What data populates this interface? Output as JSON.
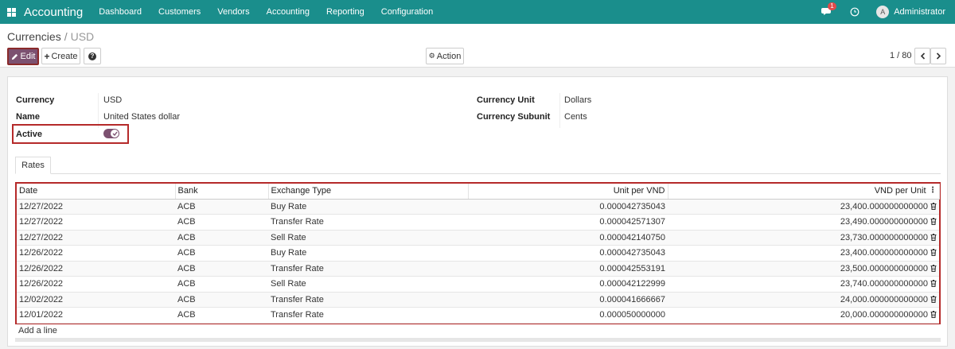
{
  "navbar": {
    "brand": "Accounting",
    "menu": [
      "Dashboard",
      "Customers",
      "Vendors",
      "Accounting",
      "Reporting",
      "Configuration"
    ],
    "messages_badge": "1",
    "avatar_letter": "A",
    "user": "Administrator"
  },
  "breadcrumb": {
    "parent": "Currencies",
    "separator": "/",
    "current": "USD"
  },
  "buttons": {
    "edit": "Edit",
    "create": "Create",
    "help": "?",
    "action": "Action"
  },
  "pager": {
    "text": "1 / 80"
  },
  "form": {
    "currency_label": "Currency",
    "currency_value": "USD",
    "name_label": "Name",
    "name_value": "United States dollar",
    "active_label": "Active",
    "active_value": true,
    "unit_label": "Currency Unit",
    "unit_value": "Dollars",
    "subunit_label": "Currency Subunit",
    "subunit_value": "Cents"
  },
  "tab": {
    "rates": "Rates"
  },
  "table": {
    "headers": {
      "date": "Date",
      "bank": "Bank",
      "type": "Exchange Type",
      "unit_per_vnd": "Unit per VND",
      "vnd_per_unit": "VND per Unit"
    },
    "rows": [
      {
        "date": "12/27/2022",
        "bank": "ACB",
        "type": "Buy Rate",
        "unit_per_vnd": "0.000042735043",
        "vnd_per_unit": "23,400.000000000000"
      },
      {
        "date": "12/27/2022",
        "bank": "ACB",
        "type": "Transfer Rate",
        "unit_per_vnd": "0.000042571307",
        "vnd_per_unit": "23,490.000000000000"
      },
      {
        "date": "12/27/2022",
        "bank": "ACB",
        "type": "Sell Rate",
        "unit_per_vnd": "0.000042140750",
        "vnd_per_unit": "23,730.000000000000"
      },
      {
        "date": "12/26/2022",
        "bank": "ACB",
        "type": "Buy Rate",
        "unit_per_vnd": "0.000042735043",
        "vnd_per_unit": "23,400.000000000000"
      },
      {
        "date": "12/26/2022",
        "bank": "ACB",
        "type": "Transfer Rate",
        "unit_per_vnd": "0.000042553191",
        "vnd_per_unit": "23,500.000000000000"
      },
      {
        "date": "12/26/2022",
        "bank": "ACB",
        "type": "Sell Rate",
        "unit_per_vnd": "0.000042122999",
        "vnd_per_unit": "23,740.000000000000"
      },
      {
        "date": "12/02/2022",
        "bank": "ACB",
        "type": "Transfer Rate",
        "unit_per_vnd": "0.000041666667",
        "vnd_per_unit": "24,000.000000000000"
      },
      {
        "date": "12/01/2022",
        "bank": "ACB",
        "type": "Transfer Rate",
        "unit_per_vnd": "0.000050000000",
        "vnd_per_unit": "20,000.000000000000"
      }
    ],
    "add_line": "Add a line"
  },
  "colors": {
    "navbar": "#1a8e8c",
    "primary_button": "#7c5170",
    "highlight_border": "#b52a2a"
  }
}
